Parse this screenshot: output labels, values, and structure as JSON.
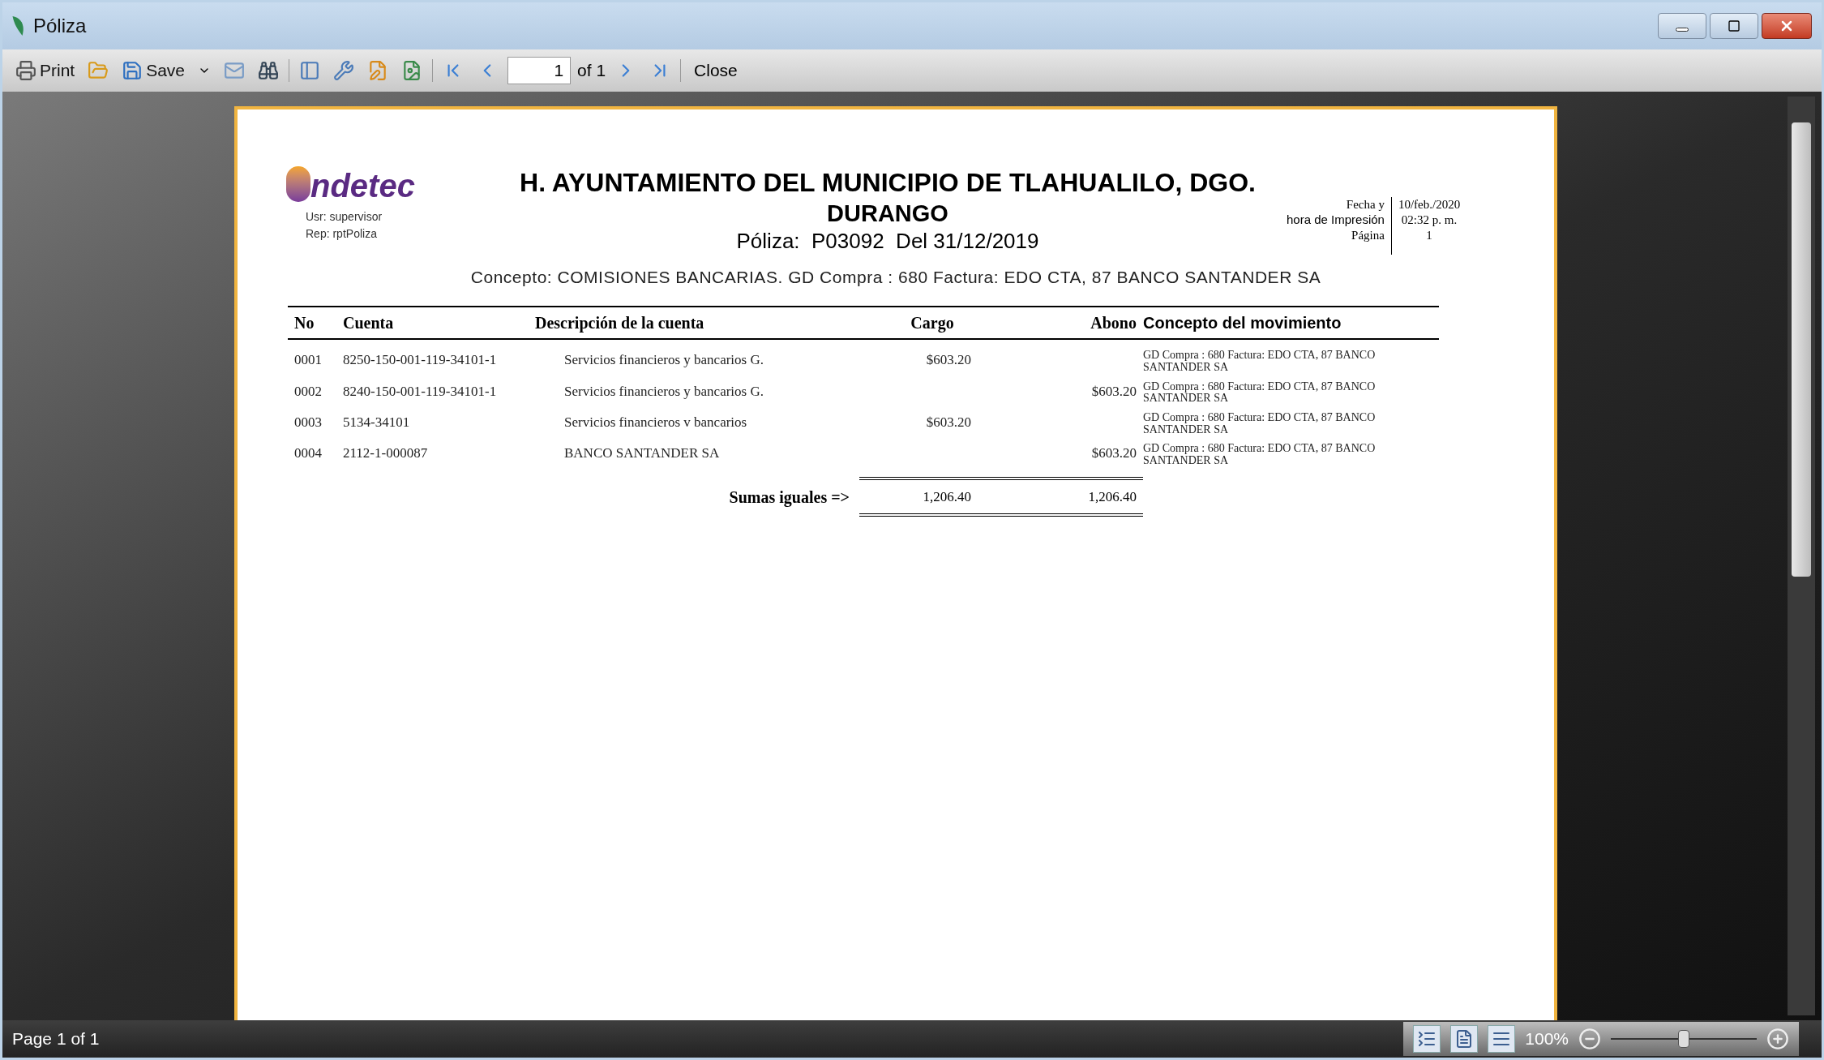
{
  "window": {
    "title": "Póliza"
  },
  "toolbar": {
    "print": "Print",
    "save": "Save",
    "page": "1",
    "page_of": "of 1",
    "close": "Close"
  },
  "report": {
    "org_title": "H. AYUNTAMIENTO DEL MUNICIPIO DE TLAHUALILO, DGO.",
    "state": "DURANGO",
    "poliza": "Póliza:  P03092  Del 31/12/2019",
    "logo_text": "ndetec",
    "user": "Usr: supervisor",
    "rep": "Rep: rptPoliza",
    "print_labels": [
      "Fecha y",
      "hora de Impresión",
      "Página"
    ],
    "print_values": [
      "10/feb./2020",
      "02:32 p. m.",
      "1"
    ],
    "concepto": "Concepto: COMISIONES BANCARIAS. GD Compra : 680 Factura: EDO CTA, 87 BANCO SANTANDER SA"
  },
  "table": {
    "columns": [
      "No",
      "Cuenta",
      "Descripción de la cuenta",
      "Cargo",
      "Abono",
      "Concepto del movimiento"
    ],
    "rows": [
      {
        "no": "0001",
        "cuenta": "8250-150-001-119-34101-1",
        "descripcion": "Servicios financieros y bancarios G.",
        "cargo": "$603.20",
        "abono": "",
        "concepto": "GD Compra : 680 Factura: EDO CTA, 87 BANCO SANTANDER SA"
      },
      {
        "no": "0002",
        "cuenta": "8240-150-001-119-34101-1",
        "descripcion": "Servicios financieros y bancarios G.",
        "cargo": "",
        "abono": "$603.20",
        "concepto": "GD Compra : 680 Factura: EDO CTA, 87 BANCO SANTANDER SA"
      },
      {
        "no": "0003",
        "cuenta": "5134-34101",
        "descripcion": "Servicios financieros v bancarios",
        "cargo": "$603.20",
        "abono": "",
        "concepto": "GD Compra : 680 Factura: EDO CTA, 87 BANCO SANTANDER SA"
      },
      {
        "no": "0004",
        "cuenta": "2112-1-000087",
        "descripcion": "BANCO SANTANDER SA",
        "cargo": "",
        "abono": "$603.20",
        "concepto": "GD Compra : 680 Factura: EDO CTA, 87 BANCO SANTANDER SA"
      }
    ],
    "totals": {
      "label": "Sumas iguales =>",
      "cargo": "1,206.40",
      "abono": "1,206.40"
    }
  },
  "status_bar": {
    "page_text": "Page 1 of 1",
    "zoom_text": "100%",
    "zoom": {
      "level": 0.5
    }
  }
}
